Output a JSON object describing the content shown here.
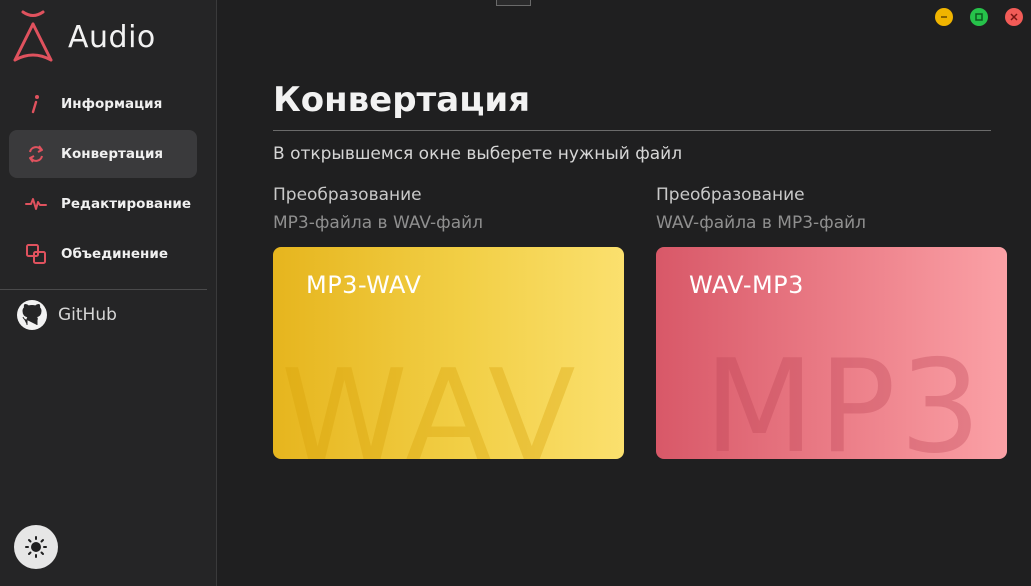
{
  "app": {
    "name": "Audio"
  },
  "sidebar": {
    "items": [
      {
        "label": "Информация",
        "icon": "info-icon"
      },
      {
        "label": "Конвертация",
        "icon": "convert-icon",
        "active": true
      },
      {
        "label": "Редактирование",
        "icon": "waveform-icon"
      },
      {
        "label": "Объединение",
        "icon": "merge-icon"
      }
    ],
    "github_label": "GitHub",
    "theme_icon": "sun-icon"
  },
  "window_controls": {
    "minimize": "minimize-icon",
    "maximize": "maximize-icon",
    "close": "close-icon"
  },
  "main": {
    "title": "Конвертация",
    "subtitle": "В открывшемся окне выберете нужный файл",
    "options": [
      {
        "heading": "Преобразование",
        "description": "MP3-файла в WAV-файл",
        "card_label": "MP3-WAV",
        "watermark": "WAV",
        "color": "#e6b51e"
      },
      {
        "heading": "Преобразование",
        "description": "WAV-файла в MP3-файл",
        "card_label": "WAV-MP3",
        "watermark": "MP3",
        "color": "#d85868"
      }
    ]
  },
  "colors": {
    "accent": "#e0525e",
    "background": "#1f1f20",
    "sidebar": "#252526"
  }
}
